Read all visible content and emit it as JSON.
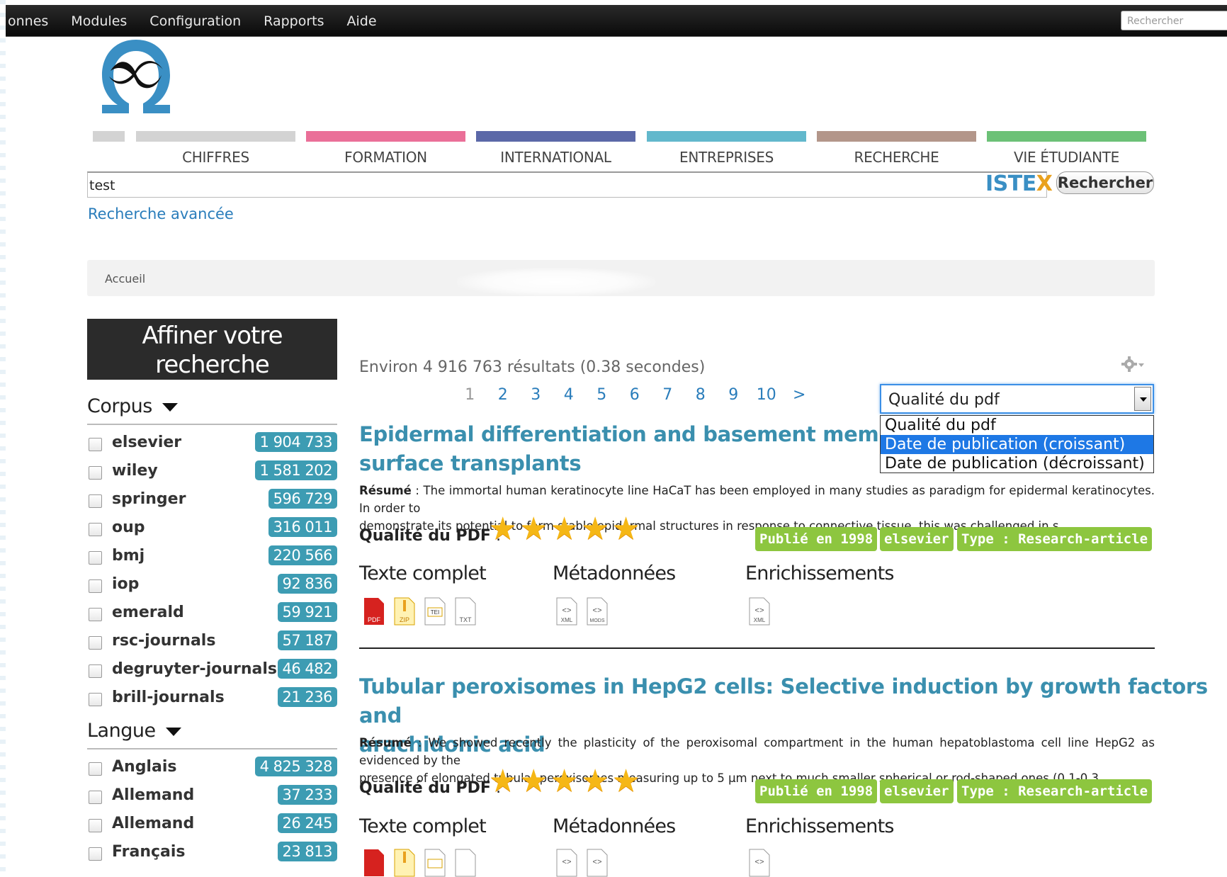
{
  "topbar": {
    "menu": [
      "onnes",
      "Modules",
      "Configuration",
      "Rapports",
      "Aide"
    ],
    "search_placeholder": "Rechercher"
  },
  "nav": {
    "items": [
      "CHIFFRES",
      "FORMATION",
      "INTERNATIONAL",
      "ENTREPRISES",
      "RECHERCHE",
      "VIE ÉTUDIANTE"
    ],
    "colors": [
      "#d3d3d3",
      "#ea6f98",
      "#5b68a8",
      "#62b8cc",
      "#b3968a",
      "#6cc177"
    ]
  },
  "search": {
    "query": "test",
    "brand_a": "ISTE",
    "brand_b": "X",
    "button": "Rechercher",
    "advanced": "Recherche avancée"
  },
  "breadcrumb": {
    "home": "Accueil"
  },
  "sidebar": {
    "refine_line1": "Affiner votre",
    "refine_line2": "recherche",
    "corpus_title": "Corpus",
    "corpus": [
      {
        "label": "elsevier",
        "count": "1 904 733"
      },
      {
        "label": "wiley",
        "count": "1 581 202"
      },
      {
        "label": "springer",
        "count": "596 729"
      },
      {
        "label": "oup",
        "count": "316 011"
      },
      {
        "label": "bmj",
        "count": "220 566"
      },
      {
        "label": "iop",
        "count": "92 836"
      },
      {
        "label": "emerald",
        "count": "59 921"
      },
      {
        "label": "rsc-journals",
        "count": "57 187"
      },
      {
        "label": "degruyter-journals",
        "count": "46 482"
      },
      {
        "label": "brill-journals",
        "count": "21 236"
      }
    ],
    "langue_title": "Langue",
    "langue": [
      {
        "label": "Anglais",
        "count": "4 825 328"
      },
      {
        "label": "Allemand",
        "count": "37 233"
      },
      {
        "label": "Allemand",
        "count": "26 245"
      },
      {
        "label": "Français",
        "count": "23 813"
      }
    ]
  },
  "results": {
    "count_text": "Environ 4 916 763 résultats (0.38 secondes)",
    "pages": [
      "1",
      "2",
      "3",
      "4",
      "5",
      "6",
      "7",
      "8",
      "9",
      "10",
      ">"
    ],
    "current_page": "1",
    "sort": {
      "selected": "Qualité du pdf",
      "options": [
        "Qualité du pdf",
        "Date de publication (croissant)",
        "Date de publication (décroissant)"
      ],
      "highlighted": "Date de publication (croissant)"
    },
    "items": [
      {
        "title_line1": "Epidermal differentiation and basement membrane for",
        "title_line2": "surface transplants",
        "abstract_label": "Résumé",
        "abstract_line1": " : The immortal human keratinocyte line HaCaT has been employed in many studies as paradigm for epidermal keratinocytes. In order to",
        "abstract_line2": "demonstrate its potential to form stable epidermal structures in response to connective tissue, this was challenged in s...",
        "quality_label": "Qualité du PDF",
        "quality_suffix": " :",
        "stars": 5,
        "tags": [
          "Publié en 1998",
          "elsevier",
          "Type : Research-article"
        ],
        "sections": [
          "Texte complet",
          "Métadonnées",
          "Enrichissements"
        ]
      },
      {
        "title_line1": "Tubular peroxisomes in HepG2 cells: Selective induction by growth factors and",
        "title_line2": "arachidonic acid",
        "abstract_label": "Résumé",
        "abstract_line1": " : We showed recently the plasticity of the peroxisomal compartment in the human hepatoblastoma cell line HepG2 as evidenced by the",
        "abstract_line2": "presence of elongated tubular peroxisomes measuring up to 5 µm next to much smaller spherical or rod-shaped ones (0.1-0.3...",
        "quality_label": "Qualité du PDF",
        "quality_suffix": " :",
        "stars": 5,
        "tags": [
          "Publié en 1998",
          "elsevier",
          "Type : Research-article"
        ],
        "sections": [
          "Texte complet",
          "Métadonnées",
          "Enrichissements"
        ]
      }
    ],
    "file_icons": {
      "fulltext": [
        "PDF",
        "ZIP",
        "TEI",
        "TXT"
      ],
      "metadata": [
        "XML",
        "MODS"
      ],
      "enrichments": [
        "XML"
      ]
    }
  },
  "colors": {
    "accent": "#3a8fae",
    "link": "#2a7dbb",
    "badge": "#3d9cb3",
    "tag": "#8dc63f",
    "star": "#f5b716"
  }
}
